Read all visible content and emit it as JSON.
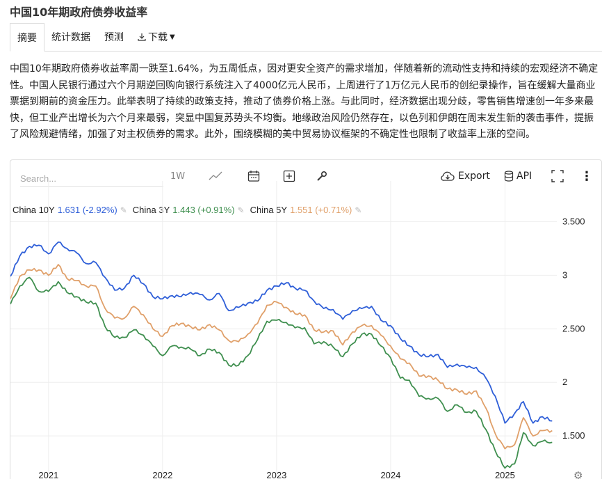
{
  "page": {
    "title": "中国10年期政府债券收益率"
  },
  "tabs": [
    {
      "label": "摘要",
      "active": true
    },
    {
      "label": "统计数据",
      "active": false
    },
    {
      "label": "预测",
      "active": false
    },
    {
      "label": "下载",
      "active": false
    }
  ],
  "summary": "中国10年期政府债券收益率周一跌至1.64%，为五周低点，因对更安全资产的需求增加，伴随着新的流动性支持和持续的宏观经济不确定性。中国人民银行通过六个月期逆回购向银行系统注入了4000亿元人民币，上周进行了1万亿元人民币的创纪录操作，旨在缓解大量商业票据到期前的资金压力。此举表明了持续的政策支持，推动了债券价格上涨。与此同时，经济数据出现分歧，零售销售增速创一年多来最快，但工业产出增长为六个月来最弱，突显中国复苏势头不均衡。地缘政治风险仍然存在，以色列和伊朗在周末发生新的袭击事件，提振了风险规避情绪，加强了对主权债券的需求。此外，围绕模糊的美中贸易协议框架的不确定性也限制了收益率上涨的空间。",
  "toolbar": {
    "search_placeholder": "Search...",
    "range_label": "1W",
    "export_label": "Export",
    "api_label": "API"
  },
  "legend": [
    {
      "name": "China 10Y",
      "value": "1.631 (-2.92%)",
      "color": "#2f5fd8"
    },
    {
      "name": "China 3Y",
      "value": "1.443 (+0.91%)",
      "color": "#3f8f4f"
    },
    {
      "name": "China 5Y",
      "value": "1.551 (+0.71%)",
      "color": "#e0a06a"
    }
  ],
  "chart_data": {
    "type": "line",
    "title": "",
    "xlabel": "",
    "ylabel": "",
    "ylim": [
      1.15,
      3.62
    ],
    "xlim": [
      "2020-09-01",
      "2025-06-16"
    ],
    "x_ticks": [
      "2021",
      "2022",
      "2023",
      "2024",
      "2025"
    ],
    "y_ticks": [
      "1.500",
      "2",
      "2.500",
      "3",
      "3.500"
    ],
    "y_tick_values": [
      1.5,
      2,
      2.5,
      3,
      3.5
    ],
    "grid": true,
    "legend_position": "top-left",
    "x": [
      "2020-09",
      "2020-10",
      "2020-11",
      "2020-12",
      "2021-01",
      "2021-02",
      "2021-03",
      "2021-04",
      "2021-05",
      "2021-06",
      "2021-07",
      "2021-08",
      "2021-09",
      "2021-10",
      "2021-11",
      "2021-12",
      "2022-01",
      "2022-02",
      "2022-03",
      "2022-04",
      "2022-05",
      "2022-06",
      "2022-07",
      "2022-08",
      "2022-09",
      "2022-10",
      "2022-11",
      "2022-12",
      "2023-01",
      "2023-02",
      "2023-03",
      "2023-04",
      "2023-05",
      "2023-06",
      "2023-07",
      "2023-08",
      "2023-09",
      "2023-10",
      "2023-11",
      "2023-12",
      "2024-01",
      "2024-02",
      "2024-03",
      "2024-04",
      "2024-05",
      "2024-06",
      "2024-07",
      "2024-08",
      "2024-09",
      "2024-10",
      "2024-11",
      "2024-12",
      "2025-01",
      "2025-02",
      "2025-03",
      "2025-04",
      "2025-05",
      "2025-06"
    ],
    "series": [
      {
        "name": "China 10Y",
        "color": "#2f5fd8",
        "values": [
          2.99,
          3.18,
          3.27,
          3.28,
          3.2,
          3.31,
          3.25,
          3.21,
          3.11,
          3.12,
          2.98,
          2.86,
          2.88,
          3.0,
          2.92,
          2.8,
          2.78,
          2.81,
          2.8,
          2.84,
          2.82,
          2.77,
          2.83,
          2.67,
          2.7,
          2.74,
          2.76,
          2.86,
          2.9,
          2.93,
          2.88,
          2.86,
          2.76,
          2.69,
          2.68,
          2.59,
          2.67,
          2.69,
          2.71,
          2.58,
          2.53,
          2.41,
          2.34,
          2.26,
          2.24,
          2.26,
          2.14,
          2.17,
          2.14,
          2.14,
          2.04,
          1.87,
          1.62,
          1.71,
          1.82,
          1.62,
          1.68,
          1.64
        ]
      },
      {
        "name": "China 5Y",
        "color": "#e0a06a",
        "values": [
          2.78,
          2.99,
          3.05,
          3.05,
          3.0,
          3.1,
          2.97,
          2.95,
          2.9,
          2.9,
          2.69,
          2.6,
          2.6,
          2.71,
          2.63,
          2.5,
          2.43,
          2.53,
          2.55,
          2.52,
          2.49,
          2.54,
          2.49,
          2.39,
          2.38,
          2.45,
          2.55,
          2.72,
          2.75,
          2.7,
          2.64,
          2.63,
          2.49,
          2.47,
          2.48,
          2.35,
          2.47,
          2.53,
          2.53,
          2.44,
          2.34,
          2.22,
          2.18,
          2.06,
          2.06,
          2.02,
          1.94,
          1.93,
          1.89,
          1.92,
          1.76,
          1.52,
          1.38,
          1.42,
          1.67,
          1.5,
          1.55,
          1.55
        ]
      },
      {
        "name": "China 3Y",
        "color": "#3f8f4f",
        "values": [
          2.73,
          2.9,
          2.98,
          2.85,
          2.85,
          2.94,
          2.84,
          2.8,
          2.75,
          2.74,
          2.52,
          2.42,
          2.42,
          2.49,
          2.44,
          2.34,
          2.25,
          2.34,
          2.33,
          2.31,
          2.25,
          2.31,
          2.28,
          2.16,
          2.16,
          2.25,
          2.4,
          2.57,
          2.58,
          2.56,
          2.51,
          2.51,
          2.36,
          2.38,
          2.33,
          2.24,
          2.36,
          2.45,
          2.45,
          2.34,
          2.23,
          2.04,
          2.02,
          1.87,
          1.85,
          1.85,
          1.73,
          1.79,
          1.72,
          1.73,
          1.56,
          1.36,
          1.2,
          1.24,
          1.53,
          1.41,
          1.45,
          1.44
        ]
      }
    ]
  }
}
